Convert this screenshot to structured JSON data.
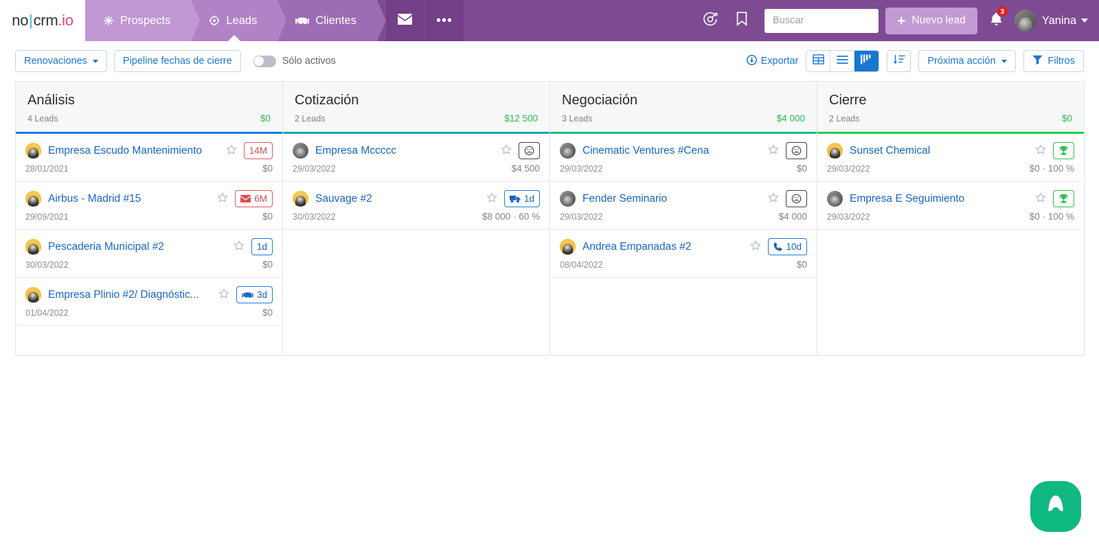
{
  "brand": {
    "part1": "no",
    "divider": "|",
    "part2": "crm",
    "part3": ".io"
  },
  "topnav": {
    "tabs": [
      {
        "label": "Prospects",
        "icon": "snowflake-icon",
        "active": false
      },
      {
        "label": "Leads",
        "icon": "target-icon",
        "active": true
      },
      {
        "label": "Clientes",
        "icon": "handshake-icon",
        "active": false
      }
    ],
    "mail_icon": "envelope-icon",
    "more_label": "•••",
    "target_icon": "goal-icon",
    "bookmark_icon": "bookmark-icon",
    "search": {
      "placeholder": "Buscar",
      "value": "",
      "icon": "search-icon"
    },
    "new_lead": {
      "label": "Nuevo lead",
      "icon": "plus-icon"
    },
    "notifications": {
      "icon": "bell-icon",
      "count": "3",
      "color": "#e02020"
    },
    "user": {
      "name": "Yanina",
      "avatar": "user-avatar",
      "caret": "chevron-down-icon"
    }
  },
  "toolbar": {
    "pipeline_select": "Renovaciones",
    "view_button": "Pipeline fechas de cierre",
    "toggle_label": "Sólo activos",
    "toggle_on": false,
    "export_label": "Exportar",
    "export_icon": "download-circle-icon",
    "views": [
      {
        "name": "grid-view",
        "icon": "grid-icon",
        "active": false
      },
      {
        "name": "list-view",
        "icon": "list-icon",
        "active": false
      },
      {
        "name": "kanban-view",
        "icon": "kanban-icon",
        "active": true
      }
    ],
    "sort_icon": "sort-descending-icon",
    "next_action_label": "Próxima acción",
    "filters_label": "Filtros",
    "filters_icon": "funnel-icon"
  },
  "board": {
    "columns": [
      {
        "title": "Análisis",
        "leads_count": "4 Leads",
        "amount": "$0",
        "accent": "#1e7ae0",
        "cards": [
          {
            "title": "Empresa Escudo Mantenimiento",
            "date": "28/01/2021",
            "amount": "$0",
            "avatar": "yellow",
            "badge": {
              "text": "14M",
              "style": "red",
              "icon": "none"
            }
          },
          {
            "title": "Airbus - Madrid #15",
            "date": "29/09/2021",
            "amount": "$0",
            "avatar": "yellow",
            "badge": {
              "text": "6M",
              "style": "red",
              "icon": "envelope-icon"
            }
          },
          {
            "title": "Pescaderia Municipal #2",
            "date": "30/03/2022",
            "amount": "$0",
            "avatar": "yellow",
            "badge": {
              "text": "1d",
              "style": "blue",
              "icon": "none"
            }
          },
          {
            "title": "Empresa Plinio #2/ Diagnóstic...",
            "date": "01/04/2022",
            "amount": "$0",
            "avatar": "yellow",
            "badge": {
              "text": "3d",
              "style": "blue",
              "icon": "handshake-icon"
            }
          }
        ]
      },
      {
        "title": "Cotización",
        "leads_count": "2 Leads",
        "amount": "$12 500",
        "accent": "#11a7b8",
        "cards": [
          {
            "title": "Empresa Mccccc",
            "date": "29/03/2022",
            "amount": "$4 500",
            "avatar": "gray",
            "badge": {
              "text": "",
              "style": "dark",
              "icon": "sad-face-icon"
            }
          },
          {
            "title": "Sauvage #2",
            "date": "30/03/2022",
            "amount": "$8 000 · 60 %",
            "avatar": "yellow",
            "badge": {
              "text": "1d",
              "style": "blue",
              "icon": "truck-icon"
            }
          }
        ]
      },
      {
        "title": "Negociación",
        "leads_count": "3 Leads",
        "amount": "$4 000",
        "accent": "#12bd7a",
        "cards": [
          {
            "title": "Cinematic Ventures #Cena",
            "date": "29/03/2022",
            "amount": "$0",
            "avatar": "gray",
            "badge": {
              "text": "",
              "style": "dark",
              "icon": "sad-face-icon"
            }
          },
          {
            "title": "Fender Seminario",
            "date": "29/03/2022",
            "amount": "$4 000",
            "avatar": "gray",
            "badge": {
              "text": "",
              "style": "dark",
              "icon": "sad-face-icon"
            }
          },
          {
            "title": "Andrea Empanadas #2",
            "date": "08/04/2022",
            "amount": "$0",
            "avatar": "yellow",
            "badge": {
              "text": "10d",
              "style": "blue",
              "icon": "phone-icon"
            }
          }
        ]
      },
      {
        "title": "Cierre",
        "leads_count": "2 Leads",
        "amount": "$0",
        "accent": "#1fd14b",
        "cards": [
          {
            "title": "Sunset Chemical",
            "date": "29/03/2022",
            "amount": "$0 · 100 %",
            "avatar": "yellow",
            "badge": {
              "text": "",
              "style": "green",
              "icon": "trophy-icon"
            }
          },
          {
            "title": "Empresa E Seguimiento",
            "date": "29/03/2022",
            "amount": "$0 · 100 %",
            "avatar": "gray",
            "badge": {
              "text": "",
              "style": "green",
              "icon": "trophy-icon"
            }
          }
        ]
      }
    ]
  },
  "fab": {
    "icon": "aircall-icon",
    "color": "#10b981"
  }
}
